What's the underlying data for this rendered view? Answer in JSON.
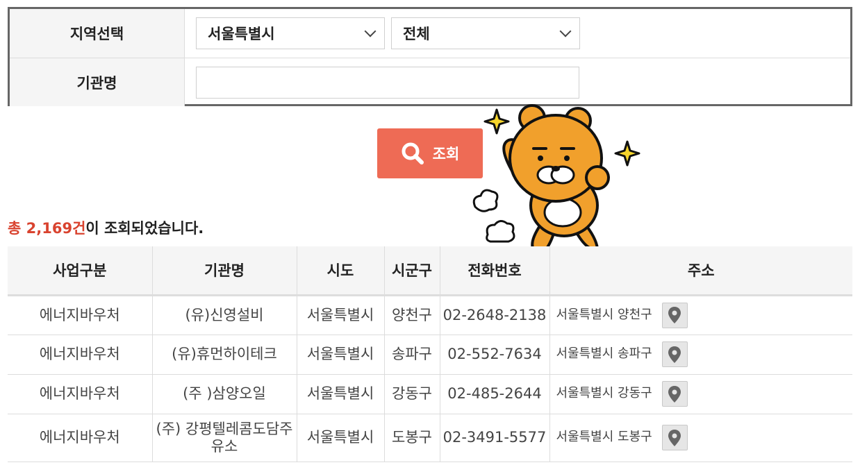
{
  "search": {
    "region_label": "지역선택",
    "region_selected": "서울특별시",
    "district_selected": "전체",
    "org_label": "기관명",
    "org_value": "",
    "button_label": "조회"
  },
  "summary": {
    "prefix": "총 ",
    "count": "2,169건",
    "suffix": "이 조회되었습니다."
  },
  "table": {
    "headers": [
      "사업구분",
      "기관명",
      "시도",
      "시군구",
      "전화번호",
      "주소"
    ],
    "rows": [
      {
        "type": "에너지바우처",
        "name": "(유)신영설비",
        "sido": "서울특별시",
        "sigungu": "양천구",
        "phone": "02-2648-2138",
        "address": "서울특별시 양천구"
      },
      {
        "type": "에너지바우처",
        "name": "(유)휴먼하이테크",
        "sido": "서울특별시",
        "sigungu": "송파구",
        "phone": "02-552-7634",
        "address": "서울특별시 송파구"
      },
      {
        "type": "에너지바우처",
        "name": "(주 )삼양오일",
        "sido": "서울특별시",
        "sigungu": "강동구",
        "phone": "02-485-2644",
        "address": "서울특별시 강동구"
      },
      {
        "type": "에너지바우처",
        "name": "(주) 강평텔레콤도담주유소",
        "sido": "서울특별시",
        "sigungu": "도봉구",
        "phone": "02-3491-5577",
        "address": "서울특별시 도봉구"
      }
    ]
  },
  "colors": {
    "button": "#ee6b55",
    "count_text": "#d9432f",
    "mascot_fur": "#f1a02c"
  },
  "icons": {
    "search_button": "search-icon",
    "map_button": "map-pin-icon",
    "select": "chevron-down-icon"
  }
}
